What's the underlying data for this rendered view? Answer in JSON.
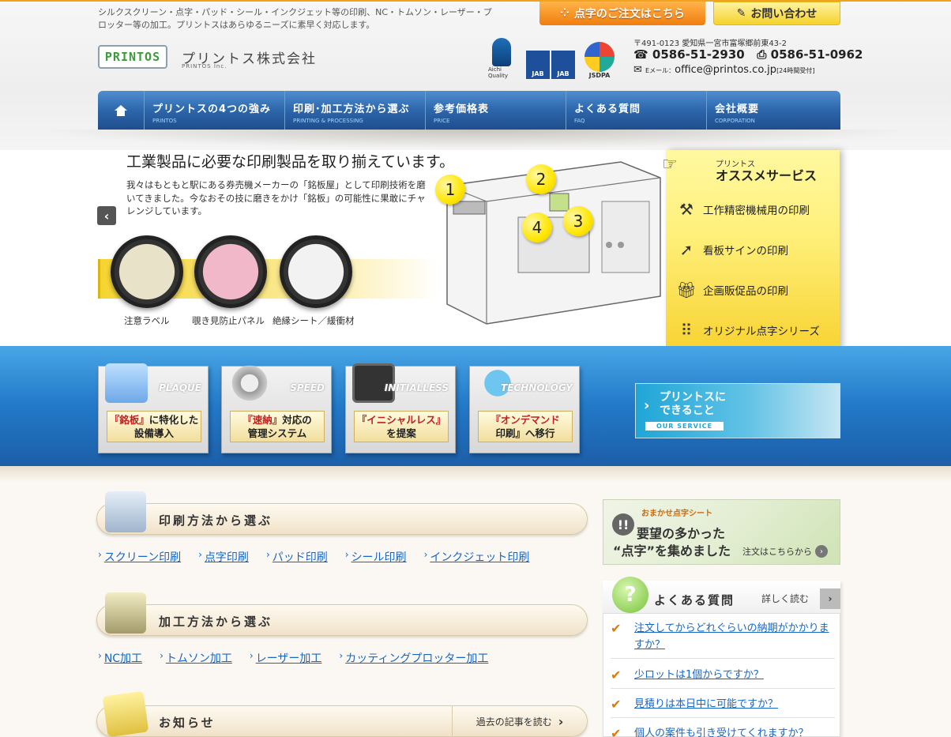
{
  "header": {
    "description": "シルクスクリーン・点字・パッド・シール・インクジェット等の印刷、NC・トムソン・レーザー・プロッター等の加工。プリントスはあらゆるニーズに素早く対応します。",
    "logo_text": "PRINTOS",
    "company_name": "プリントス株式会社",
    "company_name_en": "PRINTOS Inc.",
    "braille_order_button": "点字のご注文はこちら",
    "contact_button": "お問い合わせ",
    "certs": {
      "aichi": "Aichi Quality",
      "jab1": "JAB",
      "jab2": "JAB",
      "jsdpa": "JSDPA"
    },
    "postal_address": "〒491-0123 愛知県一宮市富塚郷前東43-2",
    "phone": "0586-51-2930",
    "fax": "0586-51-0962",
    "email_label": "Eメール：",
    "email": "office@printos.co.jp",
    "email_note": "[24時間受付]"
  },
  "nav": {
    "items": [
      {
        "label": "プリントスの4つの強み",
        "sub": "PRINTOS"
      },
      {
        "label": "印刷･加工方法から選ぶ",
        "sub": "PRINTING & PROCESSING"
      },
      {
        "label": "参考価格表",
        "sub": "PRICE"
      },
      {
        "label": "よくある質問",
        "sub": "FAQ"
      },
      {
        "label": "会社概要",
        "sub": "CORPORATION"
      }
    ]
  },
  "slider": {
    "title": "工業製品に必要な印刷製品を取り揃えています。",
    "body": "我々はもともと駅にある券売機メーカーの「銘板屋」として印刷技術を磨いてきました。今なおその技に磨きをかけ「銘板」の可能性に果敢にチャレンジしています。",
    "thumbs": [
      "注意ラベル",
      "覗き見防止パネル",
      "絶縁シート／緩衝材"
    ],
    "badges": [
      "1",
      "2",
      "3",
      "4"
    ]
  },
  "recommend": {
    "title_small": "プリントス",
    "title": "オススメサービス",
    "items": [
      {
        "label": "工作精密機械用の印刷",
        "icon": "tools-icon"
      },
      {
        "label": "看板サインの印刷",
        "icon": "arrow-icon"
      },
      {
        "label": "企画販促品の印刷",
        "icon": "gift-icon"
      },
      {
        "label": "オリジナル点字シリーズ",
        "icon": "braille-icon"
      }
    ]
  },
  "strengths": {
    "cards": [
      {
        "eng": "PLAQUE",
        "em": "『銘板』",
        "rest1": "に特化した",
        "rest2": "設備導入"
      },
      {
        "eng": "SPEED",
        "em": "『速納』",
        "rest1": "対応の",
        "rest2": "管理システム"
      },
      {
        "eng": "INITIALLESS",
        "em": "『イニシャルレス』",
        "rest1": "",
        "rest2": "を提案"
      },
      {
        "eng": "TECHNOLOGY",
        "em": "『オンデマンド",
        "rest1": "",
        "rest2": "印刷』へ移行"
      }
    ],
    "service_banner": {
      "line1": "プリントスに",
      "line2": "できること",
      "sub": "OUR SERVICE"
    }
  },
  "print_methods": {
    "heading": "印刷方法から選ぶ",
    "links": [
      "スクリーン印刷",
      "点字印刷",
      "パッド印刷",
      "シール印刷",
      "インクジェット印刷"
    ]
  },
  "process_methods": {
    "heading": "加工方法から選ぶ",
    "links": [
      "NC加工",
      "トムソン加工",
      "レーザー加工",
      "カッティングプロッター加工"
    ]
  },
  "news": {
    "heading": "お知らせ",
    "past_link": "過去の記事を読む"
  },
  "braille_promo": {
    "tag": "おまかせ点字シート",
    "line1": "要望の多かった",
    "line2": "“点字”を集めました",
    "cta": "注文はこちらから"
  },
  "faq": {
    "title": "よくある質問",
    "more": "詳しく読む",
    "items": [
      "注文してからどれぐらいの納期がかかりますか？",
      "少ロットは1個からですか？",
      "見積りは本日中に可能ですか？",
      "個人の案件も引き受けてくれますか？"
    ]
  },
  "colors": {
    "accent_orange": "#f07d10",
    "nav_blue": "#2d66ab",
    "link_blue": "#1766c4",
    "panel_yellow": "#fff07a"
  }
}
